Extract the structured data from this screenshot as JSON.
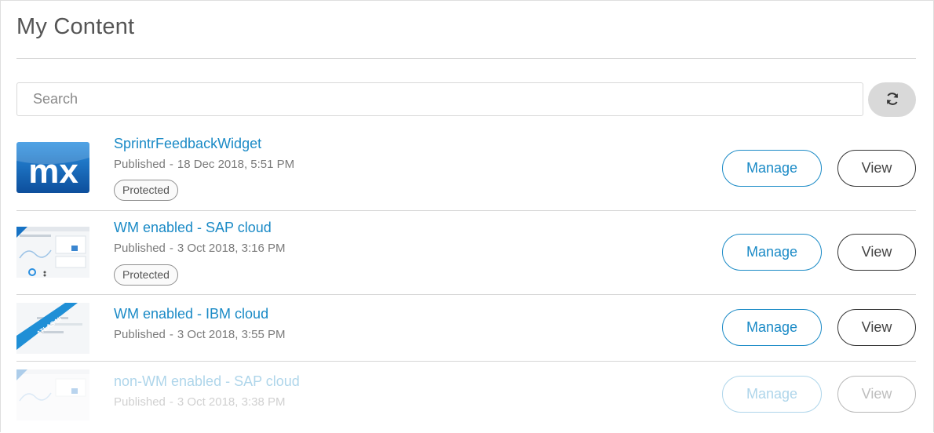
{
  "page": {
    "title": "My Content"
  },
  "search": {
    "placeholder": "Search",
    "value": ""
  },
  "refresh": {
    "icon": "refresh-icon"
  },
  "items": [
    {
      "name": "SprintrFeedbackWidget",
      "status": "Published",
      "date": "18 Dec 2018, 5:51 PM",
      "tag": "Protected",
      "thumbnail": "mx-logo",
      "manage_label": "Manage",
      "view_label": "View"
    },
    {
      "name": "WM enabled - SAP cloud",
      "status": "Published",
      "date": "3 Oct 2018, 3:16 PM",
      "tag": "Protected",
      "thumbnail": "app-screenshot",
      "manage_label": "Manage",
      "view_label": "View"
    },
    {
      "name": "WM enabled - IBM cloud",
      "status": "Published",
      "date": "3 Oct 2018, 3:55 PM",
      "tag": "",
      "thumbnail": "atlas-ui",
      "ribbon_text": "ATLAS UI",
      "manage_label": "Manage",
      "view_label": "View"
    },
    {
      "name": "non-WM enabled - SAP cloud",
      "status": "Published",
      "date": "3 Oct 2018, 3:38 PM",
      "tag": "",
      "thumbnail": "app-screenshot",
      "manage_label": "Manage",
      "view_label": "View"
    }
  ],
  "colors": {
    "link": "#1a8ac6",
    "mx_blue": "#1672c4"
  }
}
